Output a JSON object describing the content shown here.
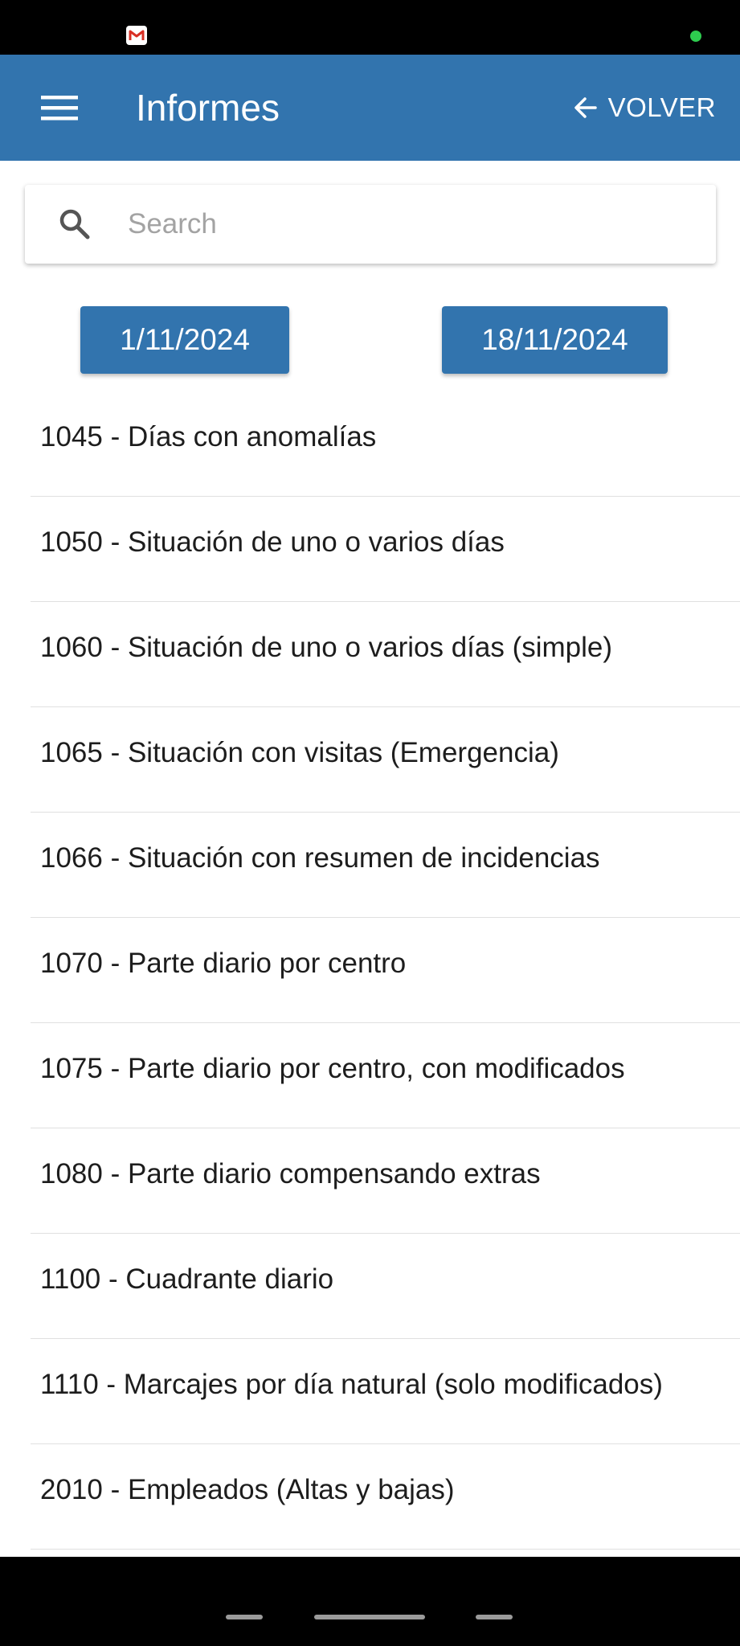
{
  "app_bar": {
    "title": "Informes",
    "back_label": "VOLVER",
    "background_color": "#3274ae"
  },
  "status_bar": {
    "notification_icon": "gmail-icon"
  },
  "search": {
    "placeholder": "Search",
    "value": ""
  },
  "date_range": {
    "start": "1/11/2024",
    "end": "18/11/2024"
  },
  "reports": [
    "1045 - Días con anomalías",
    "1050 - Situación de uno o varios días",
    "1060 - Situación de uno o varios días (simple)",
    "1065 - Situación con visitas (Emergencia)",
    "1066 - Situación con resumen de incidencias",
    "1070 - Parte diario por centro",
    "1075 - Parte diario por centro, con modificados",
    "1080 - Parte diario compensando extras",
    "1100 - Cuadrante diario",
    "1110 - Marcajes por día natural (solo modificados)",
    "2010 - Empleados (Altas y bajas)"
  ]
}
